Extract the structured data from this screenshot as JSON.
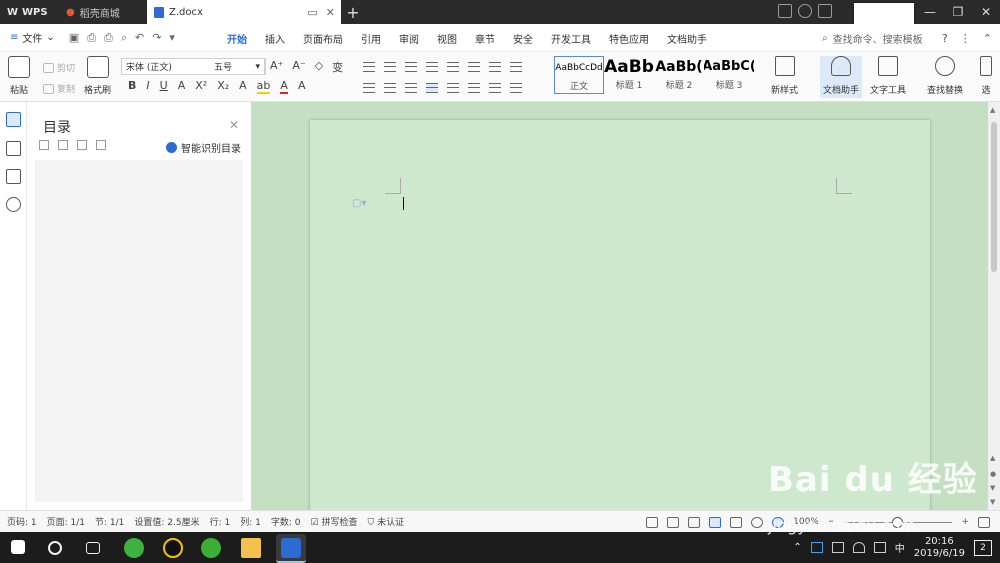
{
  "titlebar": {
    "app_name": "WPS",
    "tabs": [
      {
        "label": "稻壳商城"
      },
      {
        "label": "Z.docx"
      }
    ],
    "new_tab": "+",
    "window_controls": [
      "—",
      "❐",
      "✕"
    ]
  },
  "menubar": {
    "file_label": "文件",
    "tabs": [
      "开始",
      "插入",
      "页面布局",
      "引用",
      "审阅",
      "视图",
      "章节",
      "安全",
      "开发工具",
      "特色应用",
      "文档助手"
    ],
    "active_tab": "开始",
    "search_placeholder": "查找命令、搜索模板"
  },
  "ribbon": {
    "paste": "粘贴",
    "cut": "剪切",
    "copy": "复制",
    "format_painter": "格式刷",
    "font_name": "宋体 (正文)",
    "font_size": "五号",
    "bold": "B",
    "italic": "I",
    "underline": "U",
    "styles": [
      {
        "sample": "AaBbCcDd",
        "label": "正文"
      },
      {
        "sample": "AaBb",
        "label": "标题 1"
      },
      {
        "sample": "AaBb(",
        "label": "标题 2"
      },
      {
        "sample": "AaBbC(",
        "label": "标题 3"
      }
    ],
    "new_style": "新样式",
    "doc_assistant": "文档助手",
    "text_tools": "文字工具",
    "find_replace": "查找替换",
    "select": "选"
  },
  "toc": {
    "title": "目录",
    "smart_recognize": "智能识别目录"
  },
  "statusbar": {
    "page_num": "页码: 1",
    "pages": "页面: 1/1",
    "section": "节: 1/1",
    "setting": "设置值: 2.5厘米",
    "row": "行: 1",
    "col": "列: 1",
    "word_count": "字数: 0",
    "spell_check": "拼写检查",
    "unverified": "未认证",
    "zoom": "100%"
  },
  "taskbar": {
    "ime": "中",
    "time": "20:16",
    "date": "2019/6/19",
    "notifications": "2"
  },
  "watermark": {
    "text": "Bai du 经验",
    "url": "jingyan.baidu.com"
  },
  "colors": {
    "accent": "#2b6cd4",
    "doc_background": "#c4dfc2",
    "page": "#cde8cc",
    "titlebar": "#2b2b2b"
  }
}
